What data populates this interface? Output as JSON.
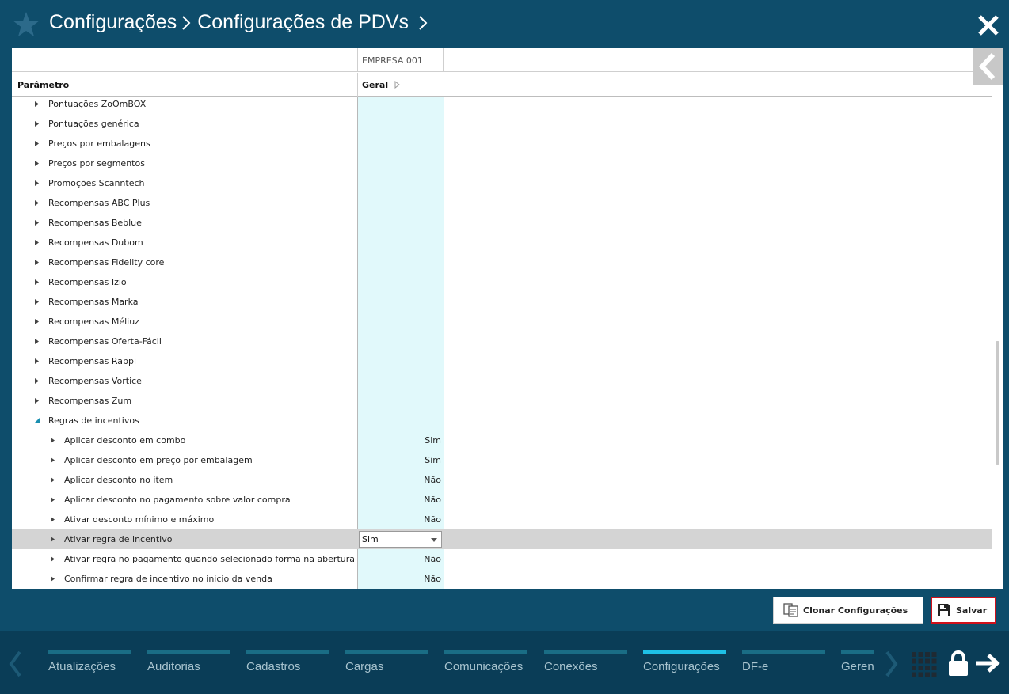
{
  "header": {
    "breadcrumb_1": "Configurações",
    "breadcrumb_2": "Configurações de PDVs"
  },
  "table": {
    "company_column": "EMPRESA 001",
    "param_header": "Parâmetro",
    "geral_header": "Geral",
    "rows": [
      {
        "label": "Pontuações ZoOmBOX",
        "value": ""
      },
      {
        "label": "Pontuações genérica",
        "value": ""
      },
      {
        "label": "Preços por embalagens",
        "value": ""
      },
      {
        "label": "Preços por segmentos",
        "value": ""
      },
      {
        "label": "Promoções Scanntech",
        "value": ""
      },
      {
        "label": "Recompensas ABC Plus",
        "value": ""
      },
      {
        "label": "Recompensas Beblue",
        "value": ""
      },
      {
        "label": "Recompensas Dubom",
        "value": ""
      },
      {
        "label": "Recompensas Fidelity core",
        "value": ""
      },
      {
        "label": "Recompensas Izio",
        "value": ""
      },
      {
        "label": "Recompensas Marka",
        "value": ""
      },
      {
        "label": "Recompensas Méliuz",
        "value": ""
      },
      {
        "label": "Recompensas Oferta-Fácil",
        "value": ""
      },
      {
        "label": "Recompensas Rappi",
        "value": ""
      },
      {
        "label": "Recompensas Vortice",
        "value": ""
      },
      {
        "label": "Recompensas Zum",
        "value": ""
      },
      {
        "label": "Regras de incentivos",
        "value": ""
      },
      {
        "label": "Aplicar desconto em combo",
        "value": "Sim"
      },
      {
        "label": "Aplicar desconto em preço por embalagem",
        "value": "Sim"
      },
      {
        "label": "Aplicar desconto no item",
        "value": "Não"
      },
      {
        "label": "Aplicar desconto no pagamento sobre valor compra",
        "value": "Não"
      },
      {
        "label": "Ativar desconto mínimo e máximo",
        "value": "Não"
      },
      {
        "label": "Ativar regra de incentivo",
        "value": "Sim"
      },
      {
        "label": "Ativar regra no pagamento quando selecionado forma na abertura",
        "value": "Não"
      },
      {
        "label": "Confirmar regra de incentivo no inicio da venda",
        "value": "Não"
      }
    ]
  },
  "buttons": {
    "clone": "Clonar Configurações",
    "save": "Salvar"
  },
  "bottom_nav": [
    {
      "label": "Atualizações"
    },
    {
      "label": "Auditorias"
    },
    {
      "label": "Cadastros"
    },
    {
      "label": "Cargas"
    },
    {
      "label": "Comunicações"
    },
    {
      "label": "Conexões"
    },
    {
      "label": "Configurações"
    },
    {
      "label": "DF-e"
    },
    {
      "label": "Gerenciamento"
    }
  ],
  "colors": {
    "header_bg": "#0e4d6b",
    "bottom_bg": "#0a3d57",
    "cyan_column": "#e1f9fb",
    "active_tab": "#1ec0e6",
    "save_border": "#d0101a"
  }
}
